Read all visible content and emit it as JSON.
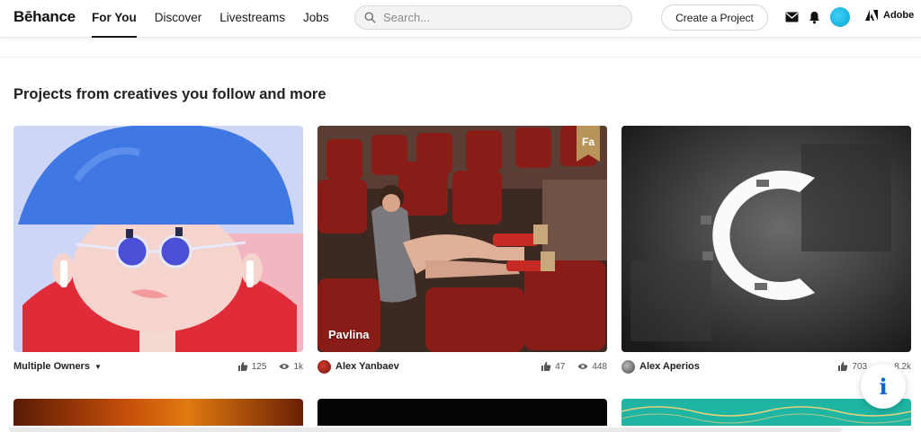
{
  "header": {
    "logo": "Bēhance",
    "nav": [
      "For You",
      "Discover",
      "Livestreams",
      "Jobs"
    ],
    "active_nav": "For You",
    "search_placeholder": "Search...",
    "create_label": "Create a Project",
    "adobe_label": "Adobe"
  },
  "section_title": "Projects from creatives you follow and more",
  "cards": [
    {
      "title": "",
      "owner": "Multiple Owners",
      "likes": "125",
      "views": "1k"
    },
    {
      "title": "Pavlina",
      "badge": "Fa",
      "owner": "Alex Yanbaev",
      "likes": "47",
      "views": "448"
    },
    {
      "title": "",
      "owner": "Alex Aperios",
      "likes": "703",
      "views": "8.2k"
    }
  ],
  "info_icon": "i",
  "colors": {
    "accent": "#0d66d0",
    "active_underline": "#191919",
    "badge_gold": "#b8935a"
  }
}
